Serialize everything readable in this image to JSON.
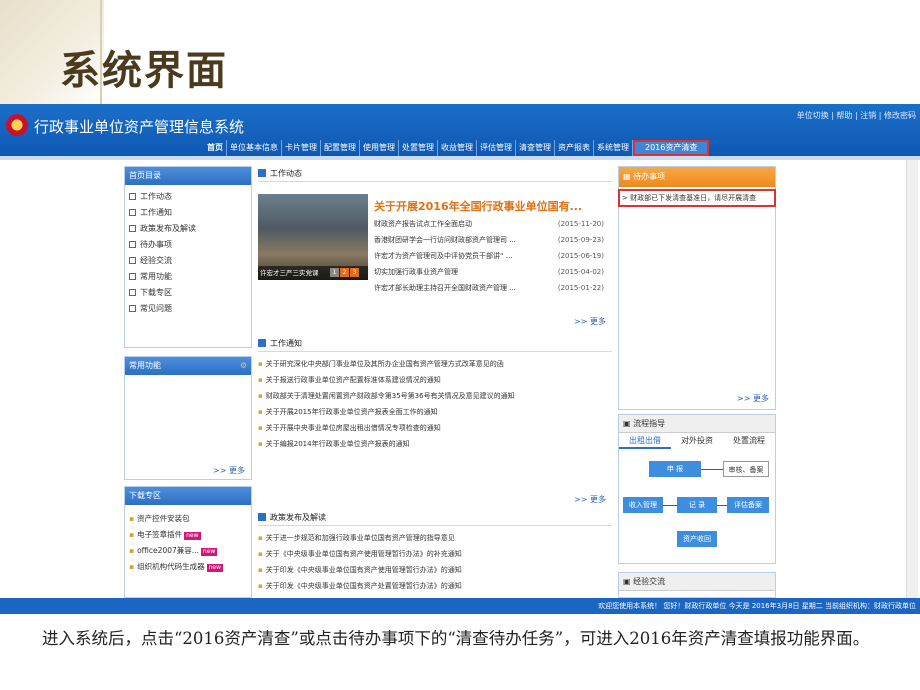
{
  "slide": {
    "title": "系统界面"
  },
  "app": {
    "system_title": "行政事业单位资产管理信息系统",
    "top_links": "单位切换 | 帮助 | 注销 | 修改密码",
    "nav": [
      "首页",
      "单位基本信息",
      "卡片管理",
      "配置管理",
      "使用管理",
      "处置管理",
      "收益管理",
      "评估管理",
      "清查管理",
      "资产报表",
      "系统管理",
      "2016资产清查"
    ],
    "left": {
      "home_dir": {
        "title": "首页目录",
        "items": [
          "工作动态",
          "工作通知",
          "政策发布及解读",
          "待办事项",
          "经验交流",
          "常用功能",
          "下载专区",
          "常见问题"
        ]
      },
      "common": {
        "title": "常用功能",
        "more": ">> 更多"
      },
      "download": {
        "title": "下载专区",
        "items": [
          {
            "label": "资产控件安装包",
            "new": ""
          },
          {
            "label": "电子签章插件",
            "new": "new"
          },
          {
            "label": "office2007兼容...",
            "new": "new"
          },
          {
            "label": "组织机构代码生成器",
            "new": "new"
          }
        ]
      }
    },
    "center": {
      "work_news": {
        "title": "工作动态",
        "headline": "关于开展2016年全国行政事业单位国有...",
        "photo_caption": "许宏才三严三实党课",
        "pager": [
          "1",
          "2",
          "3"
        ],
        "rows": [
          {
            "text": "财政资产报告试点工作全面启动",
            "date": "(2015-11-20)"
          },
          {
            "text": "香港财团研学会一行访问财政部资产管理司 ...",
            "date": "(2015-09-23)"
          },
          {
            "text": "许宏才为资产管理司及中评协党员干部讲“ ...",
            "date": "(2015-06-19)"
          },
          {
            "text": "切实加强行政事业资产管理",
            "date": "(2015-04-02)"
          },
          {
            "text": "许宏才部长助理主持召开全国财政资产管理 ...",
            "date": "(2015-01-22)"
          }
        ],
        "more": ">> 更多"
      },
      "work_notice": {
        "title": "工作通知",
        "rows": [
          "关于研究深化中央部门事业单位及其所办企业国有资产管理方式改革意见的函",
          "关于报送行政事业单位资产配置标准体系建设情况的通知",
          "财政部关于清理处置闲置资产财政部令第35号第36号有关情况及意见建议的通知",
          "关于开展2015年行政事业单位资产报表全面工作的通知",
          "关于开展中央事业单位房屋出租出借情况专项检查的通知",
          "关于编报2014年行政事业单位资产报表的通知"
        ],
        "more": ">> 更多"
      },
      "policy": {
        "title": "政策发布及解读",
        "rows": [
          "关于进一步规范和加强行政事业单位国有资产管理的指导意见",
          "关于《中央级事业单位国有资产使用管理暂行办法》的补充通知",
          "关于印发《中央级事业单位国有资产使用管理暂行办法》的通知",
          "关于印发《中央级事业单位国有资产处置管理暂行办法》的通知"
        ]
      }
    },
    "right": {
      "todo": {
        "title": "待办事项",
        "item": "> 财政部已下发清查基准日，请尽开展清查",
        "more": ">> 更多"
      },
      "flow": {
        "title": "流程指导",
        "tabs": [
          "出租出借",
          "对外投资",
          "处置流程"
        ],
        "boxes": {
          "apply": "申 报",
          "review": "审核、备案",
          "income": "收入管理",
          "record": "记 录",
          "eval": "评估备案",
          "collect": "资产收回"
        }
      },
      "exp": {
        "title": "经验交流"
      }
    },
    "footer": "欢迎您使用本系统！ 您好！财政行政单位 今天是 2016年3月8日 星期二 当前组织机构：财政行政单位"
  },
  "caption": "进入系统后，点击“2016资产清查”或点击待办事项下的“清查待办任务”，可进入2016年资产清查填报功能界面。"
}
